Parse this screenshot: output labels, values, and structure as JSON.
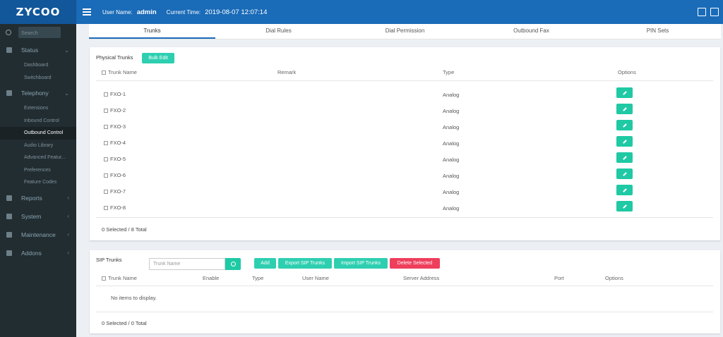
{
  "header": {
    "logo": "ZYCOO",
    "user_label": "User Name:",
    "user_value": "admin",
    "time_label": "Current Time:",
    "time_value": "2019-08-07 12:07:14"
  },
  "sidebar": {
    "search_placeholder": "Search",
    "groups": [
      {
        "label": "Status",
        "icon": "dashboard-icon"
      },
      {
        "label": "Telephony",
        "icon": "phone-icon"
      },
      {
        "label": "Reports",
        "icon": "bar-chart-icon"
      },
      {
        "label": "System",
        "icon": "server-icon"
      },
      {
        "label": "Maintenance",
        "icon": "gear-icon"
      },
      {
        "label": "Addons",
        "icon": "sitemap-icon"
      }
    ],
    "status_items": [
      "Dashboard",
      "Switchboard"
    ],
    "telephony_items": [
      "Extensions",
      "Inbound Control",
      "Outbound Control",
      "Audio Library",
      "Advanced Featur...",
      "Preferences",
      "Feature Codes"
    ]
  },
  "tabs": [
    "Trunks",
    "Dial Rules",
    "Dial Permission",
    "Outbound Fax",
    "PIN Sets"
  ],
  "physical": {
    "title": "Physical Trunks",
    "bulk_edit": "Bulk Edit",
    "columns": [
      "Trunk Name",
      "Remark",
      "Type",
      "Options"
    ],
    "rows": [
      {
        "name": "FXO-1",
        "type": "Analog"
      },
      {
        "name": "FXO-2",
        "type": "Analog"
      },
      {
        "name": "FXO-3",
        "type": "Analog"
      },
      {
        "name": "FXO-4",
        "type": "Analog"
      },
      {
        "name": "FXO-5",
        "type": "Analog"
      },
      {
        "name": "FXO-6",
        "type": "Analog"
      },
      {
        "name": "FXO-7",
        "type": "Analog"
      },
      {
        "name": "FXO-8",
        "type": "Analog"
      }
    ],
    "summary": "0 Selected / 8 Total"
  },
  "sip": {
    "title": "SIP Trunks",
    "search_placeholder": "Trunk Name",
    "buttons": {
      "add": "Add",
      "export": "Export SIP Trunks",
      "import": "Import SIP Trunks",
      "delete": "Delete Selected"
    },
    "columns": [
      "Trunk Name",
      "Enable",
      "Type",
      "User Name",
      "Server Address",
      "Port",
      "Options"
    ],
    "empty": "No items to display.",
    "summary": "0 Selected / 0 Total"
  }
}
